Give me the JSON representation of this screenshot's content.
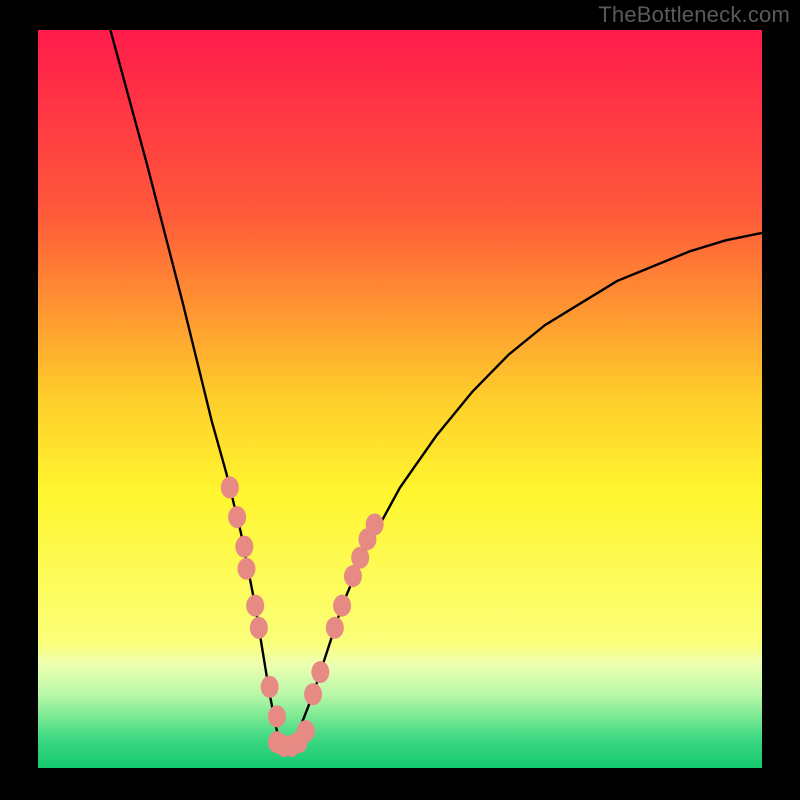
{
  "watermark": "TheBottleneck.com",
  "chart_data": {
    "type": "line",
    "title": "",
    "xlabel": "",
    "ylabel": "",
    "xlim": [
      0,
      100
    ],
    "ylim": [
      0,
      100
    ],
    "x": [
      10,
      15,
      20,
      22,
      24,
      26,
      28,
      30,
      31,
      32,
      33,
      34,
      35,
      36,
      38,
      40,
      42,
      45,
      50,
      55,
      60,
      65,
      70,
      75,
      80,
      85,
      90,
      95,
      100
    ],
    "values": [
      100,
      82,
      63,
      55,
      47,
      40,
      32,
      22,
      16,
      10,
      5,
      3,
      3,
      5,
      10,
      16,
      22,
      29,
      38,
      45,
      51,
      56,
      60,
      63,
      66,
      68,
      70,
      71.5,
      72.5
    ],
    "gradient_stops": [
      {
        "pos": 0.0,
        "color": "#ff1b4b"
      },
      {
        "pos": 0.25,
        "color": "#ff5a3a"
      },
      {
        "pos": 0.5,
        "color": "#ffce2b"
      },
      {
        "pos": 0.63,
        "color": "#fff62f"
      },
      {
        "pos": 0.83,
        "color": "#fbff7a"
      },
      {
        "pos": 0.86,
        "color": "#ecffb0"
      },
      {
        "pos": 0.9,
        "color": "#b9f8a8"
      },
      {
        "pos": 0.93,
        "color": "#7be993"
      },
      {
        "pos": 0.96,
        "color": "#3fd883"
      },
      {
        "pos": 1.0,
        "color": "#14c96f"
      }
    ],
    "markers_left": [
      {
        "x": 26.5,
        "y": 38
      },
      {
        "x": 27.5,
        "y": 34
      },
      {
        "x": 28.5,
        "y": 30
      },
      {
        "x": 28.8,
        "y": 27
      },
      {
        "x": 30.0,
        "y": 22
      },
      {
        "x": 30.5,
        "y": 19
      },
      {
        "x": 32.0,
        "y": 11
      },
      {
        "x": 33.0,
        "y": 7
      }
    ],
    "markers_right": [
      {
        "x": 38.0,
        "y": 10
      },
      {
        "x": 39.0,
        "y": 13
      },
      {
        "x": 41.0,
        "y": 19
      },
      {
        "x": 42.0,
        "y": 22
      },
      {
        "x": 43.5,
        "y": 26
      },
      {
        "x": 44.5,
        "y": 28.5
      },
      {
        "x": 45.5,
        "y": 31
      },
      {
        "x": 46.5,
        "y": 33
      }
    ],
    "markers_bottom": [
      {
        "x": 33.0,
        "y": 3.5
      },
      {
        "x": 34.0,
        "y": 3
      },
      {
        "x": 35.0,
        "y": 3
      },
      {
        "x": 36.0,
        "y": 3.5
      },
      {
        "x": 37.0,
        "y": 5
      }
    ],
    "marker_color": "#e78a83",
    "marker_radius_x": 9,
    "marker_radius_y": 11
  }
}
